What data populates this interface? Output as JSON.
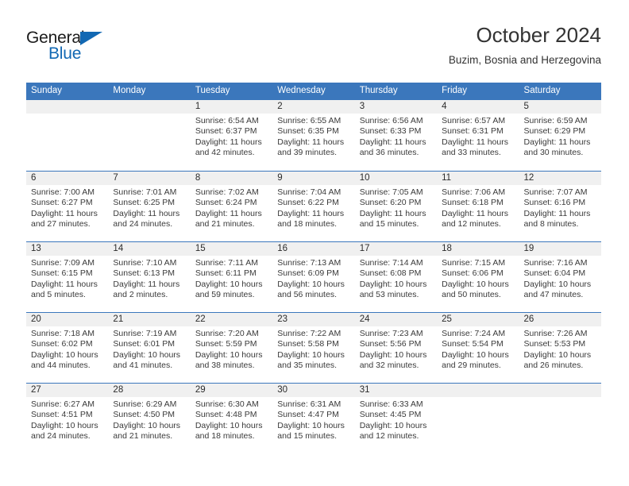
{
  "logo": {
    "word_one": "General",
    "word_two": "Blue",
    "triangle_icon": "blue-triangle-icon",
    "blue_hex": "#1268b3"
  },
  "header": {
    "title": "October 2024",
    "location": "Buzim, Bosnia and Herzegovina"
  },
  "theme": {
    "header_blue": "#3b77bc",
    "day_band_gray": "#f0f0f0",
    "text": "#3a3a3a"
  },
  "weekdays": [
    "Sunday",
    "Monday",
    "Tuesday",
    "Wednesday",
    "Thursday",
    "Friday",
    "Saturday"
  ],
  "labels": {
    "sunrise_prefix": "Sunrise:",
    "sunset_prefix": "Sunset:",
    "daylight_prefix": "Daylight:"
  },
  "weeks": [
    [
      {
        "day": "",
        "sunrise": "",
        "sunset": "",
        "daylight_line1": "",
        "daylight_line2": "",
        "empty": true
      },
      {
        "day": "",
        "sunrise": "",
        "sunset": "",
        "daylight_line1": "",
        "daylight_line2": "",
        "empty": true
      },
      {
        "day": "1",
        "sunrise": "Sunrise: 6:54 AM",
        "sunset": "Sunset: 6:37 PM",
        "daylight_line1": "Daylight: 11 hours",
        "daylight_line2": "and 42 minutes."
      },
      {
        "day": "2",
        "sunrise": "Sunrise: 6:55 AM",
        "sunset": "Sunset: 6:35 PM",
        "daylight_line1": "Daylight: 11 hours",
        "daylight_line2": "and 39 minutes."
      },
      {
        "day": "3",
        "sunrise": "Sunrise: 6:56 AM",
        "sunset": "Sunset: 6:33 PM",
        "daylight_line1": "Daylight: 11 hours",
        "daylight_line2": "and 36 minutes."
      },
      {
        "day": "4",
        "sunrise": "Sunrise: 6:57 AM",
        "sunset": "Sunset: 6:31 PM",
        "daylight_line1": "Daylight: 11 hours",
        "daylight_line2": "and 33 minutes."
      },
      {
        "day": "5",
        "sunrise": "Sunrise: 6:59 AM",
        "sunset": "Sunset: 6:29 PM",
        "daylight_line1": "Daylight: 11 hours",
        "daylight_line2": "and 30 minutes."
      }
    ],
    [
      {
        "day": "6",
        "sunrise": "Sunrise: 7:00 AM",
        "sunset": "Sunset: 6:27 PM",
        "daylight_line1": "Daylight: 11 hours",
        "daylight_line2": "and 27 minutes."
      },
      {
        "day": "7",
        "sunrise": "Sunrise: 7:01 AM",
        "sunset": "Sunset: 6:25 PM",
        "daylight_line1": "Daylight: 11 hours",
        "daylight_line2": "and 24 minutes."
      },
      {
        "day": "8",
        "sunrise": "Sunrise: 7:02 AM",
        "sunset": "Sunset: 6:24 PM",
        "daylight_line1": "Daylight: 11 hours",
        "daylight_line2": "and 21 minutes."
      },
      {
        "day": "9",
        "sunrise": "Sunrise: 7:04 AM",
        "sunset": "Sunset: 6:22 PM",
        "daylight_line1": "Daylight: 11 hours",
        "daylight_line2": "and 18 minutes."
      },
      {
        "day": "10",
        "sunrise": "Sunrise: 7:05 AM",
        "sunset": "Sunset: 6:20 PM",
        "daylight_line1": "Daylight: 11 hours",
        "daylight_line2": "and 15 minutes."
      },
      {
        "day": "11",
        "sunrise": "Sunrise: 7:06 AM",
        "sunset": "Sunset: 6:18 PM",
        "daylight_line1": "Daylight: 11 hours",
        "daylight_line2": "and 12 minutes."
      },
      {
        "day": "12",
        "sunrise": "Sunrise: 7:07 AM",
        "sunset": "Sunset: 6:16 PM",
        "daylight_line1": "Daylight: 11 hours",
        "daylight_line2": "and 8 minutes."
      }
    ],
    [
      {
        "day": "13",
        "sunrise": "Sunrise: 7:09 AM",
        "sunset": "Sunset: 6:15 PM",
        "daylight_line1": "Daylight: 11 hours",
        "daylight_line2": "and 5 minutes."
      },
      {
        "day": "14",
        "sunrise": "Sunrise: 7:10 AM",
        "sunset": "Sunset: 6:13 PM",
        "daylight_line1": "Daylight: 11 hours",
        "daylight_line2": "and 2 minutes."
      },
      {
        "day": "15",
        "sunrise": "Sunrise: 7:11 AM",
        "sunset": "Sunset: 6:11 PM",
        "daylight_line1": "Daylight: 10 hours",
        "daylight_line2": "and 59 minutes."
      },
      {
        "day": "16",
        "sunrise": "Sunrise: 7:13 AM",
        "sunset": "Sunset: 6:09 PM",
        "daylight_line1": "Daylight: 10 hours",
        "daylight_line2": "and 56 minutes."
      },
      {
        "day": "17",
        "sunrise": "Sunrise: 7:14 AM",
        "sunset": "Sunset: 6:08 PM",
        "daylight_line1": "Daylight: 10 hours",
        "daylight_line2": "and 53 minutes."
      },
      {
        "day": "18",
        "sunrise": "Sunrise: 7:15 AM",
        "sunset": "Sunset: 6:06 PM",
        "daylight_line1": "Daylight: 10 hours",
        "daylight_line2": "and 50 minutes."
      },
      {
        "day": "19",
        "sunrise": "Sunrise: 7:16 AM",
        "sunset": "Sunset: 6:04 PM",
        "daylight_line1": "Daylight: 10 hours",
        "daylight_line2": "and 47 minutes."
      }
    ],
    [
      {
        "day": "20",
        "sunrise": "Sunrise: 7:18 AM",
        "sunset": "Sunset: 6:02 PM",
        "daylight_line1": "Daylight: 10 hours",
        "daylight_line2": "and 44 minutes."
      },
      {
        "day": "21",
        "sunrise": "Sunrise: 7:19 AM",
        "sunset": "Sunset: 6:01 PM",
        "daylight_line1": "Daylight: 10 hours",
        "daylight_line2": "and 41 minutes."
      },
      {
        "day": "22",
        "sunrise": "Sunrise: 7:20 AM",
        "sunset": "Sunset: 5:59 PM",
        "daylight_line1": "Daylight: 10 hours",
        "daylight_line2": "and 38 minutes."
      },
      {
        "day": "23",
        "sunrise": "Sunrise: 7:22 AM",
        "sunset": "Sunset: 5:58 PM",
        "daylight_line1": "Daylight: 10 hours",
        "daylight_line2": "and 35 minutes."
      },
      {
        "day": "24",
        "sunrise": "Sunrise: 7:23 AM",
        "sunset": "Sunset: 5:56 PM",
        "daylight_line1": "Daylight: 10 hours",
        "daylight_line2": "and 32 minutes."
      },
      {
        "day": "25",
        "sunrise": "Sunrise: 7:24 AM",
        "sunset": "Sunset: 5:54 PM",
        "daylight_line1": "Daylight: 10 hours",
        "daylight_line2": "and 29 minutes."
      },
      {
        "day": "26",
        "sunrise": "Sunrise: 7:26 AM",
        "sunset": "Sunset: 5:53 PM",
        "daylight_line1": "Daylight: 10 hours",
        "daylight_line2": "and 26 minutes."
      }
    ],
    [
      {
        "day": "27",
        "sunrise": "Sunrise: 6:27 AM",
        "sunset": "Sunset: 4:51 PM",
        "daylight_line1": "Daylight: 10 hours",
        "daylight_line2": "and 24 minutes."
      },
      {
        "day": "28",
        "sunrise": "Sunrise: 6:29 AM",
        "sunset": "Sunset: 4:50 PM",
        "daylight_line1": "Daylight: 10 hours",
        "daylight_line2": "and 21 minutes."
      },
      {
        "day": "29",
        "sunrise": "Sunrise: 6:30 AM",
        "sunset": "Sunset: 4:48 PM",
        "daylight_line1": "Daylight: 10 hours",
        "daylight_line2": "and 18 minutes."
      },
      {
        "day": "30",
        "sunrise": "Sunrise: 6:31 AM",
        "sunset": "Sunset: 4:47 PM",
        "daylight_line1": "Daylight: 10 hours",
        "daylight_line2": "and 15 minutes."
      },
      {
        "day": "31",
        "sunrise": "Sunrise: 6:33 AM",
        "sunset": "Sunset: 4:45 PM",
        "daylight_line1": "Daylight: 10 hours",
        "daylight_line2": "and 12 minutes."
      },
      {
        "day": "",
        "sunrise": "",
        "sunset": "",
        "daylight_line1": "",
        "daylight_line2": "",
        "empty": true
      },
      {
        "day": "",
        "sunrise": "",
        "sunset": "",
        "daylight_line1": "",
        "daylight_line2": "",
        "empty": true
      }
    ]
  ]
}
